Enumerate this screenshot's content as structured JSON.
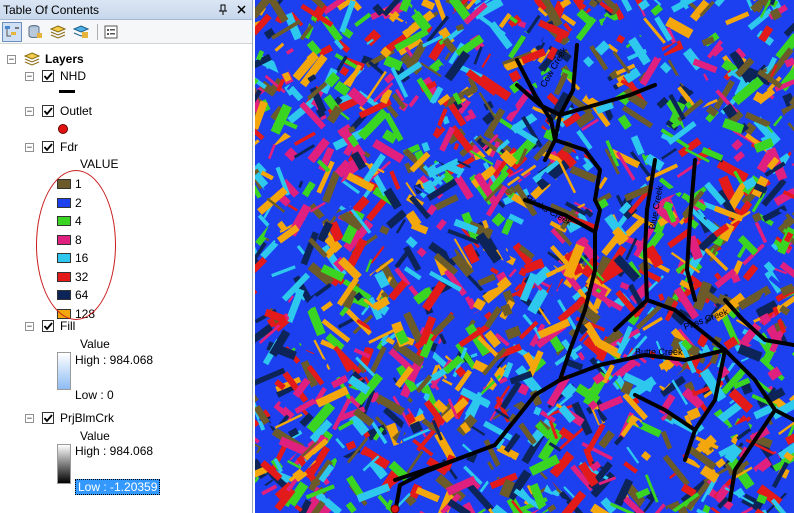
{
  "window": {
    "title": "Table Of Contents",
    "pin": "ᵖ",
    "close": "×"
  },
  "toolbar": {
    "buttons": [
      "list-by-drawing-order-icon",
      "list-by-source-icon",
      "list-by-visibility-icon",
      "list-by-selection-icon",
      "options-icon"
    ]
  },
  "tree": {
    "root_label": "Layers",
    "layers": [
      {
        "name": "NHD",
        "checked": true
      },
      {
        "name": "Outlet",
        "checked": true
      },
      {
        "name": "Fdr",
        "checked": true,
        "field": "VALUE",
        "classes": [
          {
            "label": "1",
            "color": "#6b5a2a"
          },
          {
            "label": "2",
            "color": "#1c3ff0"
          },
          {
            "label": "4",
            "color": "#3ad423"
          },
          {
            "label": "8",
            "color": "#e0207f"
          },
          {
            "label": "16",
            "color": "#2ec8ef"
          },
          {
            "label": "32",
            "color": "#e21a1a"
          },
          {
            "label": "64",
            "color": "#0c2457"
          },
          {
            "label": "128",
            "color": "#f3a70c"
          }
        ]
      },
      {
        "name": "Fill",
        "checked": true,
        "value_label": "Value",
        "high": "High : 984.068",
        "low": "Low : 0"
      },
      {
        "name": "PrjBlmCrk",
        "checked": true,
        "value_label": "Value",
        "high": "High : 984.068",
        "low": "Low : -1.20359"
      }
    ]
  },
  "annotation": {
    "color": "#c81e1e"
  },
  "map": {
    "labels": [
      "Cow Creek",
      "Rocks Creek",
      "Butte Creek",
      "Blue Creek",
      "Pass Creek"
    ]
  }
}
